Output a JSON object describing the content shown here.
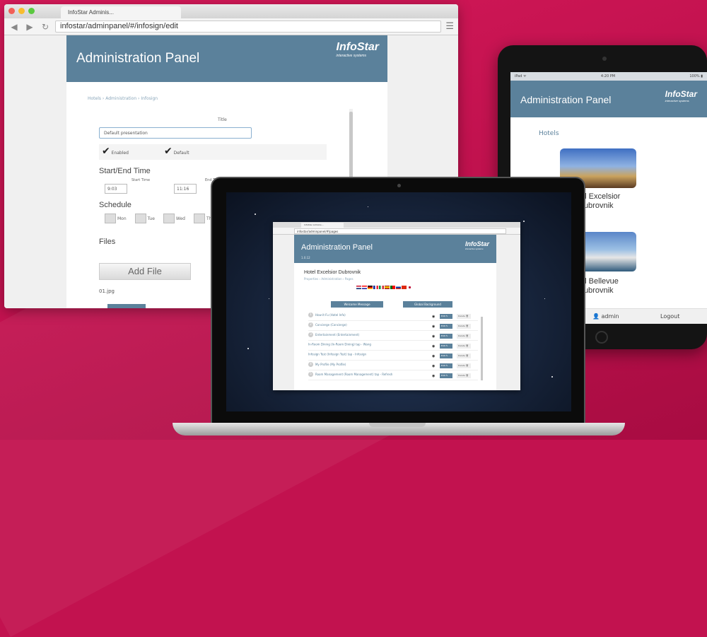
{
  "browser": {
    "tab_title": "InfoStar Adminis...",
    "url": "infostar/adminpanel/#/infosign/edit",
    "panel_title": "Administration Panel",
    "logo": "InfoStar",
    "logo_sub": "interactive systems",
    "breadcrumb": "Hotels › Administration › Infosign",
    "title_label": "Title",
    "title_value": "Default presentation",
    "enabled_label": "Enabled",
    "default_label": "Default",
    "start_end_heading": "Start/End Time",
    "start_time_label": "Start Time",
    "end_time_label": "End Time",
    "start_time_value": "9:03",
    "end_time_value": "11:16",
    "schedule_heading": "Schedule",
    "days": [
      "Mon",
      "Tue",
      "Wed",
      "Thu"
    ],
    "files_heading": "Files",
    "add_file_label": "Add File",
    "file_name": "01.jpg"
  },
  "tablet": {
    "status_left": "iPad ᯤ",
    "status_center": "4:20 PM",
    "status_right": "100% ▮",
    "panel_title": "Administration Panel",
    "logo": "InfoStar",
    "logo_sub": "interactive systems",
    "hotels_link": "Hotels",
    "hotel1_line1": "tel Excelsior",
    "hotel1_line2": "Dubrovnik",
    "hotel2_line1": "tel Bellevue",
    "hotel2_line2": "Dubrovnik",
    "footer_user": "admin",
    "footer_logout": "Logout"
  },
  "laptop": {
    "tab_title": "InfoStar Adminis...",
    "url": "infostar/adminpanel/#/pages",
    "panel_title": "Administration Panel",
    "version": "1.0.12",
    "logo": "InfoStar",
    "logo_sub": "interactive systems",
    "hotel_title": "Hotel Excelsior Dubrovnik",
    "breadcrumb": "Properties › Administration › Pages",
    "welcome_btn": "Welcome Message",
    "bg_btn": "Global Background",
    "rows": [
      {
        "num": "1",
        "label": "How-it-Fu (Hotel Info)"
      },
      {
        "num": "2",
        "label": "Concierge (Concierge)"
      },
      {
        "num": "3",
        "label": "Entertainment (Entertainment)"
      },
      {
        "num": "",
        "label": "In-Room Dining (In-Room Dining)   tap - Wang"
      },
      {
        "num": "",
        "label": "Infosign Test (Infosign Test)   tap - Infosign"
      },
      {
        "num": "4",
        "label": "My Profile (My Profile)"
      },
      {
        "num": "5",
        "label": "Room Management (Room Management)   tap - Refresh"
      }
    ],
    "edit_label": "Edit ✎",
    "delete_label": "Delete 🗑"
  },
  "colors": {
    "accent": "#5b819b",
    "background": "#c2124f"
  }
}
